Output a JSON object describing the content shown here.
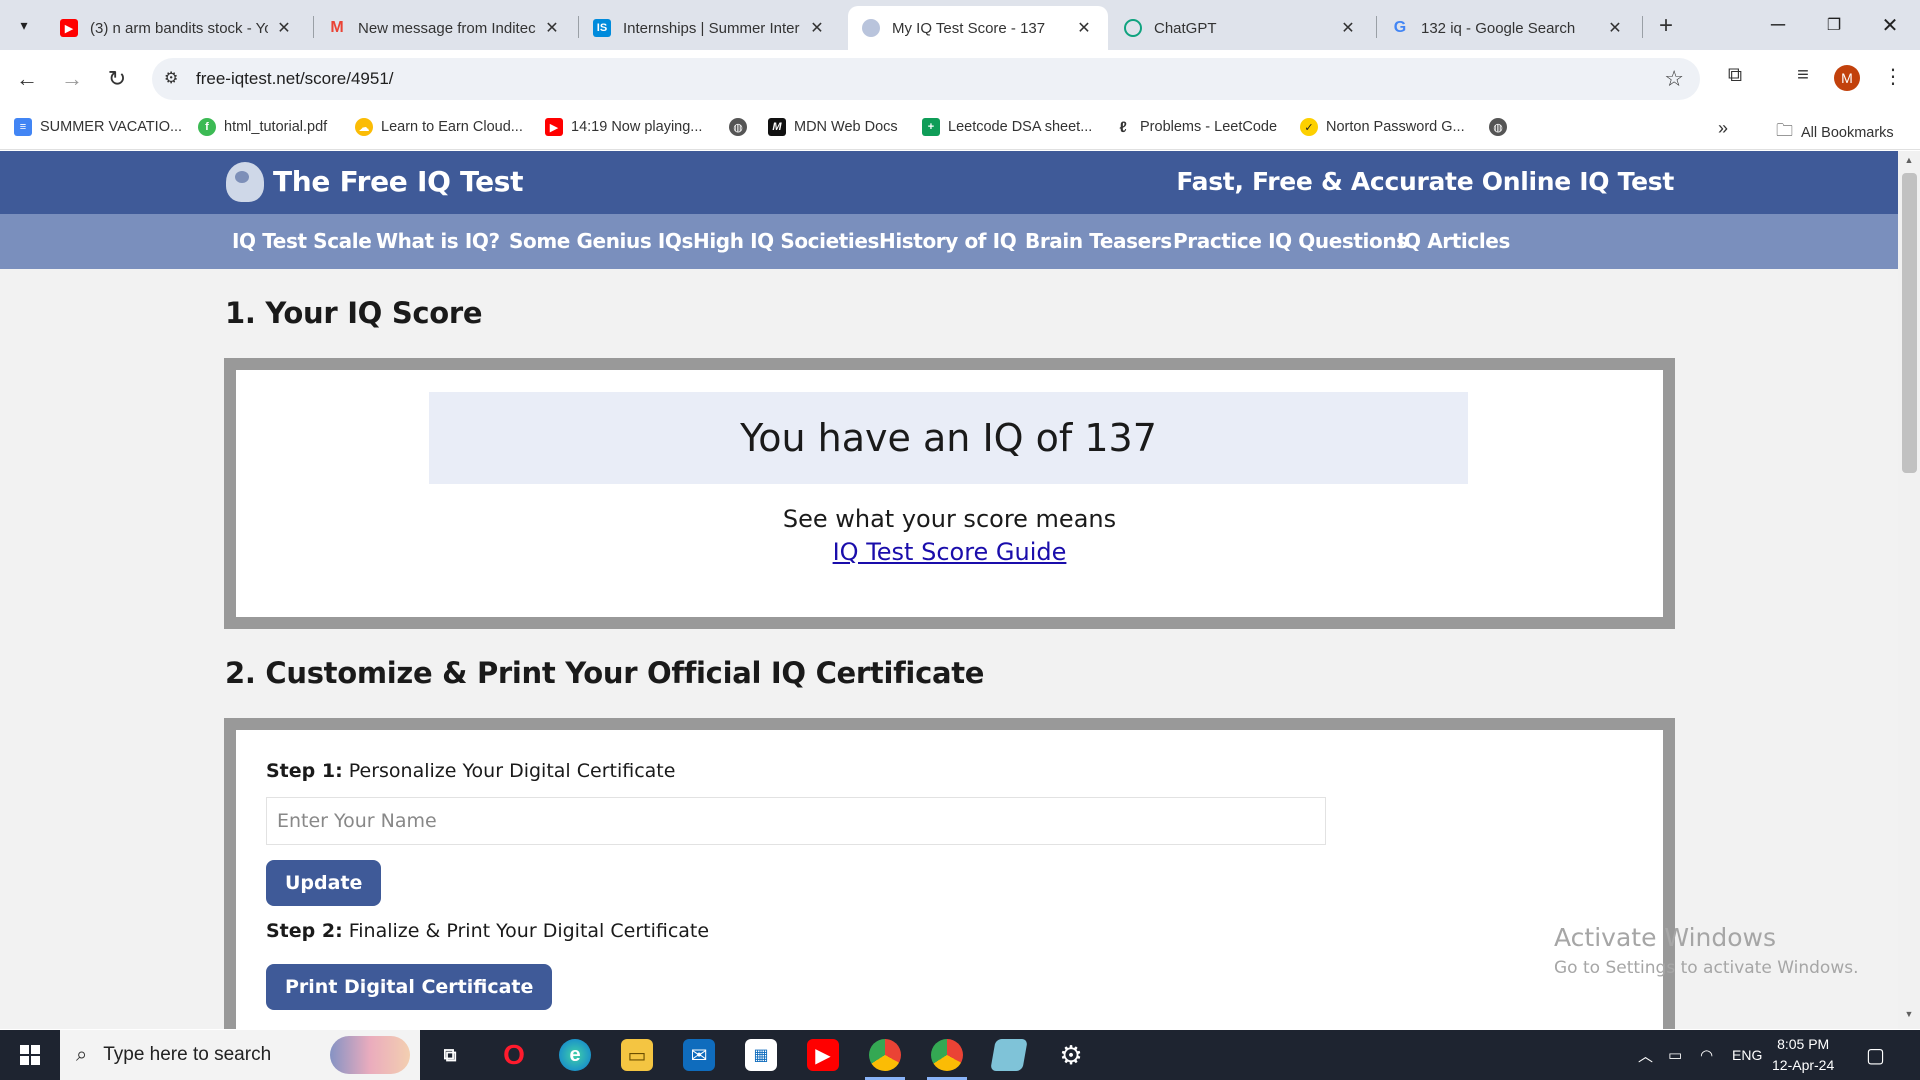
{
  "browser": {
    "tabs": [
      {
        "title": "(3) n arm bandits stock - Yo",
        "favicon": "youtube-icon"
      },
      {
        "title": "New message from Inditec",
        "favicon": "gmail-icon"
      },
      {
        "title": "Internships | Summer Inter",
        "favicon": "internshala-icon"
      },
      {
        "title": "My IQ Test Score - 137",
        "favicon": "brain-icon",
        "active": true
      },
      {
        "title": "ChatGPT",
        "favicon": "chatgpt-icon"
      },
      {
        "title": "132 iq - Google Search",
        "favicon": "google-icon"
      }
    ],
    "url": "free-iqtest.net/score/4951/",
    "profile_initial": "M",
    "bookmarks": [
      {
        "label": "SUMMER VACATIO...",
        "icon": "docs-icon"
      },
      {
        "label": "html_tutorial.pdf",
        "icon": "pdf-icon"
      },
      {
        "label": "Learn to Earn Cloud...",
        "icon": "cloud-icon"
      },
      {
        "label": "14:19 Now playing...",
        "icon": "youtube-icon"
      },
      {
        "label": "",
        "icon": "globe-icon"
      },
      {
        "label": "MDN Web Docs",
        "icon": "mdn-icon"
      },
      {
        "label": "Leetcode DSA sheet...",
        "icon": "sheets-icon"
      },
      {
        "label": "Problems - LeetCode",
        "icon": "leetcode-icon"
      },
      {
        "label": "Norton Password G...",
        "icon": "norton-icon"
      },
      {
        "label": "",
        "icon": "globe-icon"
      }
    ],
    "all_bookmarks": "All Bookmarks"
  },
  "site": {
    "title": "The Free IQ Test",
    "tagline": "Fast, Free & Accurate Online IQ Test",
    "nav": [
      "IQ Test Scale",
      "What is IQ?",
      "Some Genius IQs",
      "High IQ Societies",
      "History of IQ",
      "Brain Teasers",
      "Practice IQ Questions",
      "IQ Articles"
    ]
  },
  "score_section": {
    "heading": "1. Your IQ Score",
    "result": "You have an IQ of 137",
    "means": "See what your score means",
    "link": "IQ Test Score Guide"
  },
  "certificate_section": {
    "heading": "2. Customize & Print Your Official IQ Certificate",
    "step1_label": "Step 1:",
    "step1_text": " Personalize Your Digital Certificate",
    "name_placeholder": "Enter Your Name",
    "update_button": "Update",
    "step2_label": "Step 2:",
    "step2_text": " Finalize & Print Your Digital Certificate",
    "print_button": "Print Digital Certificate"
  },
  "watermark": {
    "line1": "Activate Windows",
    "line2": "Go to Settings to activate Windows."
  },
  "taskbar": {
    "search_placeholder": "Type here to search",
    "language": "ENG",
    "time": "8:05 PM",
    "date": "12-Apr-24"
  },
  "colors": {
    "header": "#3f5a98",
    "nav": "#7a8fbd",
    "button": "#3f5a98",
    "link": "#1a0dab"
  }
}
